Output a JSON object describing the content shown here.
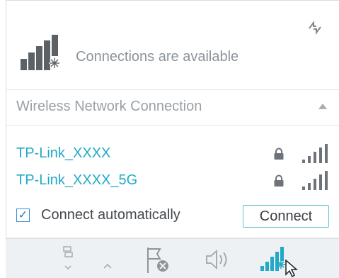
{
  "status": {
    "message": "Connections are available",
    "icon": "signal-bars-with-sparkle-icon"
  },
  "refresh": {
    "icon": "refresh-arrows-icon"
  },
  "section": {
    "title": "Wireless Network Connection",
    "state": "expanded"
  },
  "networks": [
    {
      "ssid": "TP-Link_XXXX",
      "secured": true,
      "signal_bars": 5
    },
    {
      "ssid": "TP-Link_XXXX_5G",
      "secured": true,
      "signal_bars": 5
    }
  ],
  "connect_automatically": {
    "label": "Connect automatically",
    "checked": true,
    "check_glyph": "✓"
  },
  "connect_button": {
    "label": "Connect"
  },
  "taskbar": {
    "icons": [
      "network-devices-icon",
      "show-hidden-icons-caret",
      "action-center-flag-icon",
      "speaker-volume-icon",
      "wireless-signal-icon"
    ]
  },
  "colors": {
    "accent": "#22a9c6",
    "button_border": "#5fc1d6",
    "muted_text": "#8b949b",
    "taskbar_bg": "#eef1f4"
  }
}
